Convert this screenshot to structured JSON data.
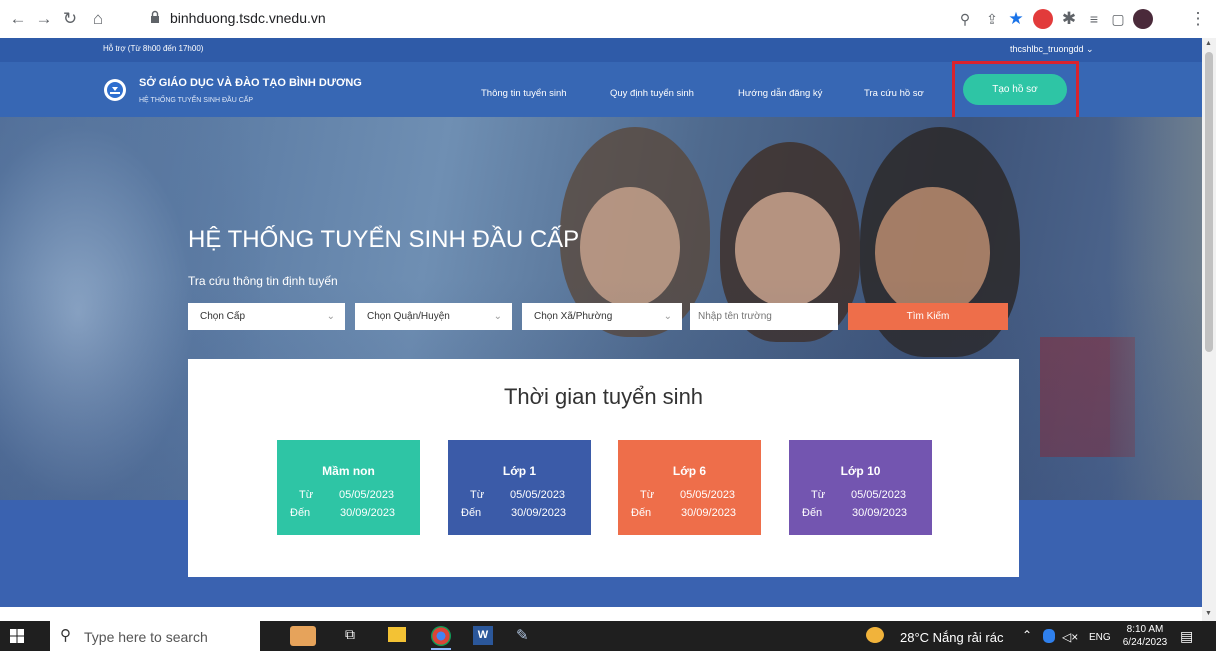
{
  "browser": {
    "url": "binhduong.tsdc.vnedu.vn"
  },
  "topbar": {
    "support": "Hỗ trợ (Từ 8h00 đến 17h00)",
    "user": "thcshlbc_truongdd ⌄"
  },
  "header": {
    "org_title": "SỞ GIÁO DỤC VÀ ĐÀO TẠO BÌNH DƯƠNG",
    "org_subtitle": "HỆ THỐNG TUYỂN SINH ĐẦU CẤP",
    "nav": [
      {
        "label": "Thông tin tuyển sinh"
      },
      {
        "label": "Quy định tuyển sinh"
      },
      {
        "label": "Hướng dẫn đăng ký"
      },
      {
        "label": "Tra cứu hồ sơ"
      }
    ],
    "cta": "Tạo hồ sơ"
  },
  "hero": {
    "title": "HỆ THỐNG TUYỂN SINH ĐẦU CẤP",
    "subtitle": "Tra cứu thông tin định tuyến",
    "select_level": "Chọn Cấp",
    "select_district": "Chọn Quận/Huyện",
    "select_ward": "Chọn Xã/Phường",
    "school_placeholder": "Nhập tên trường",
    "search_button": "Tìm Kiếm"
  },
  "schedule": {
    "title": "Thời gian tuyển sinh",
    "from_label": "Từ",
    "to_label": "Đến",
    "cards": [
      {
        "name": "Mầm non",
        "from": "05/05/2023",
        "to": "30/09/2023",
        "color": "#2ec5a5"
      },
      {
        "name": "Lớp 1",
        "from": "05/05/2023",
        "to": "30/09/2023",
        "color": "#3b5ba8"
      },
      {
        "name": "Lớp 6",
        "from": "05/05/2023",
        "to": "30/09/2023",
        "color": "#ee6e4a"
      },
      {
        "name": "Lớp 10",
        "from": "05/05/2023",
        "to": "30/09/2023",
        "color": "#7355b0"
      }
    ]
  },
  "taskbar": {
    "search_placeholder": "Type here to search",
    "weather": "28°C  Nắng rải rác",
    "lang": "ENG",
    "time": "8:10 AM",
    "date": "6/24/2023"
  },
  "colors": {
    "header": "#3767b4",
    "cta": "#2ec5a5",
    "search_button": "#ee6e4a",
    "highlight": "#d9232e"
  }
}
